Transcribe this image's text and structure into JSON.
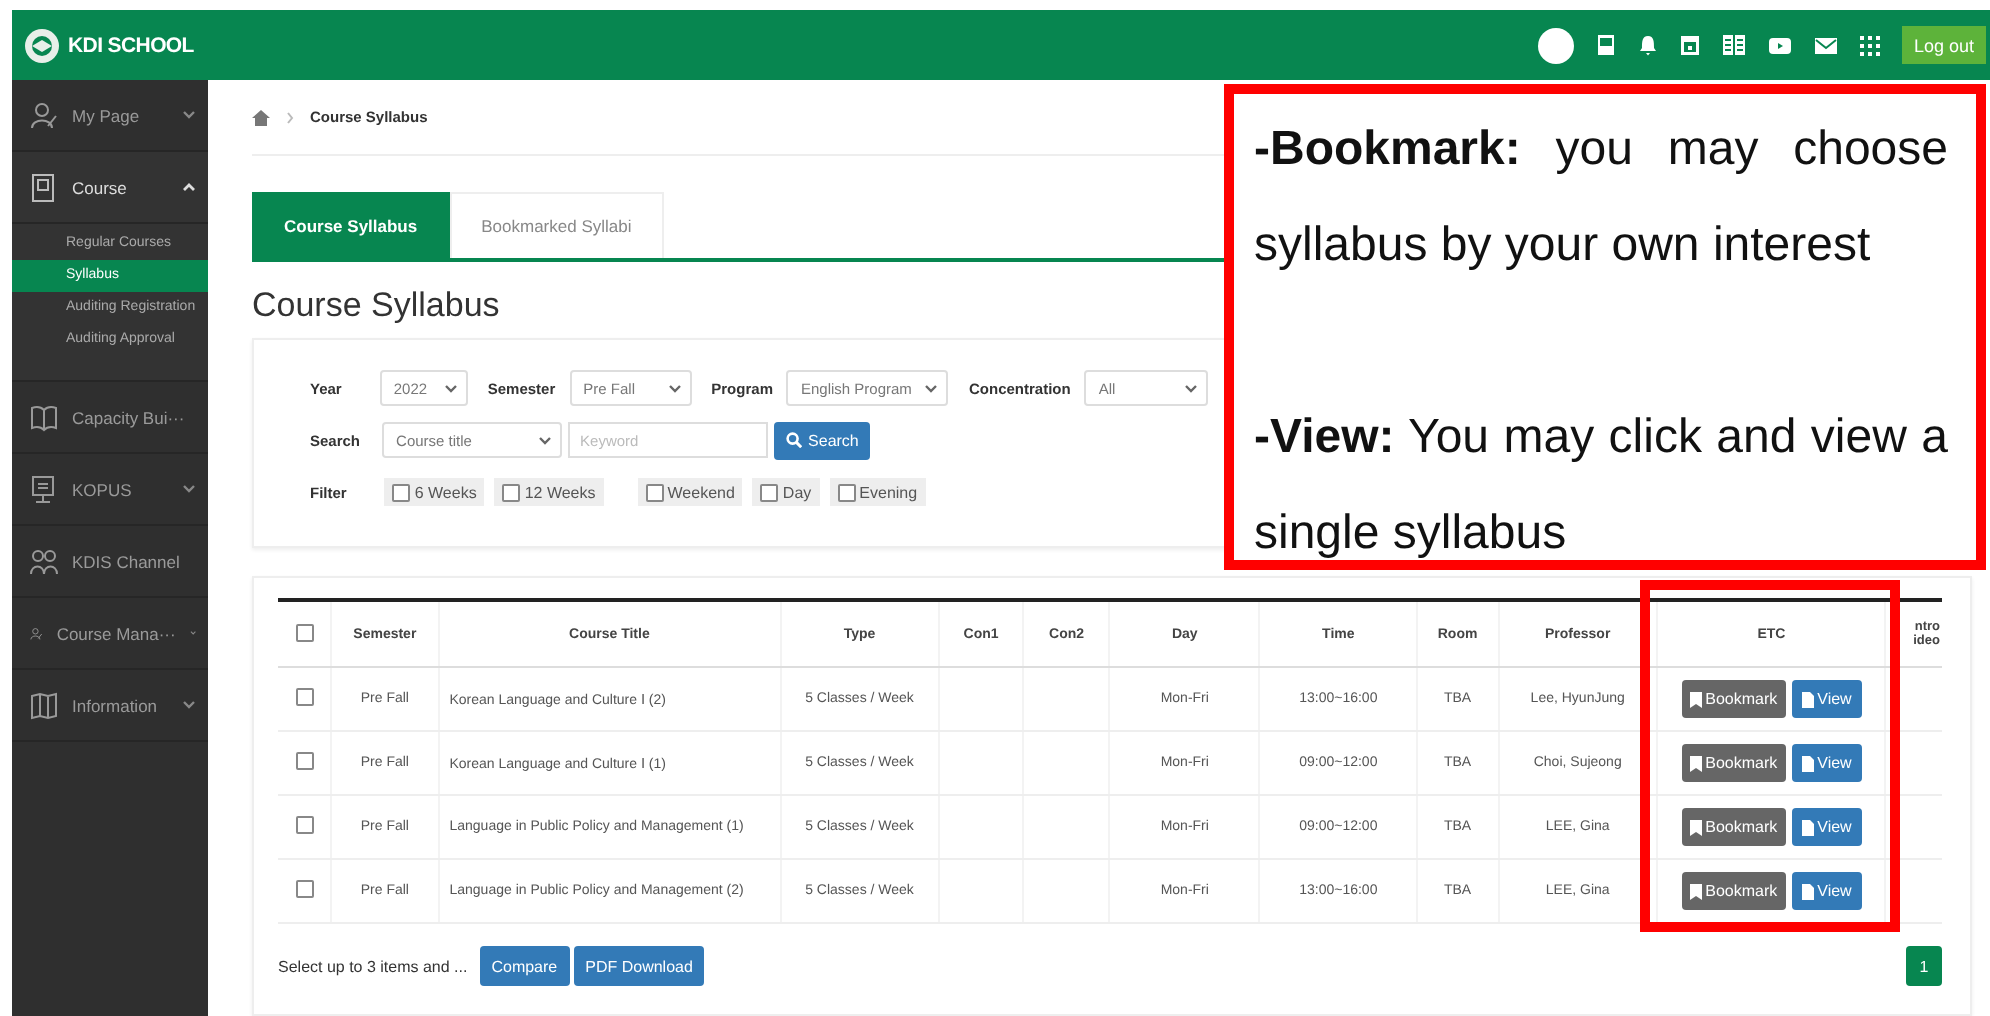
{
  "header": {
    "logo": "KDI SCHOOL",
    "logout": "Log out"
  },
  "sidebar": {
    "items": [
      {
        "label": "My Page",
        "kind": "group",
        "expanded": false
      },
      {
        "label": "Course",
        "kind": "group",
        "expanded": true,
        "children": [
          {
            "label": "Regular Courses",
            "selected": false
          },
          {
            "label": "Syllabus",
            "selected": true
          },
          {
            "label": "Auditing Registration",
            "selected": false
          },
          {
            "label": "Auditing Approval",
            "selected": false
          }
        ]
      },
      {
        "label": "Capacity Bui···",
        "kind": "link"
      },
      {
        "label": "KOPUS",
        "kind": "group",
        "expanded": false
      },
      {
        "label": "KDIS Channel",
        "kind": "link"
      },
      {
        "label": "Course Mana···",
        "kind": "group",
        "expanded": false
      },
      {
        "label": "Information",
        "kind": "group",
        "expanded": false
      }
    ]
  },
  "breadcrumb": "Course Syllabus",
  "tabs": [
    {
      "label": "Course Syllabus",
      "selected": true
    },
    {
      "label": "Bookmarked Syllabi",
      "selected": false
    }
  ],
  "title": "Course Syllabus",
  "filters": {
    "selects": [
      {
        "label": "Year",
        "value": "2022"
      },
      {
        "label": "Semester",
        "value": "Pre Fall"
      },
      {
        "label": "Program",
        "value": "English Program"
      },
      {
        "label": "Concentration",
        "value": "All"
      }
    ],
    "search": {
      "label": "Search",
      "field": "Course title",
      "placeholder": "Keyword",
      "button": "Search"
    },
    "filter": {
      "label": "Filter",
      "options": [
        {
          "label": "6 Weeks",
          "checked": false
        },
        {
          "label": "12 Weeks",
          "checked": false
        },
        {
          "label": "Weekend",
          "checked": false
        },
        {
          "label": "Day",
          "checked": false
        },
        {
          "label": "Evening",
          "checked": false
        }
      ]
    }
  },
  "table": {
    "columns": [
      "Semester",
      "Course Title",
      "Type",
      "Con1",
      "Con2",
      "Day",
      "Time",
      "Room",
      "Professor",
      "ETC",
      "ntro ideo"
    ],
    "all_checked": false,
    "rows": [
      {
        "checked": false,
        "cells": [
          "Pre Fall",
          "Korean Language and Culture Ⅰ (2)",
          "5 Classes / Week",
          "",
          "",
          "Mon-Fri",
          "13:00~16:00",
          "TBA",
          "Lee, HyunJung"
        ],
        "actions": [
          "Bookmark",
          "View"
        ]
      },
      {
        "checked": false,
        "cells": [
          "Pre Fall",
          "Korean Language and Culture Ⅰ (1)",
          "5 Classes / Week",
          "",
          "",
          "Mon-Fri",
          "09:00~12:00",
          "TBA",
          "Choi, Sujeong"
        ],
        "actions": [
          "Bookmark",
          "View"
        ]
      },
      {
        "checked": false,
        "cells": [
          "Pre Fall",
          "Language in Public Policy and Management (1)",
          "5 Classes / Week",
          "",
          "",
          "Mon-Fri",
          "09:00~12:00",
          "TBA",
          "LEE, Gina"
        ],
        "actions": [
          "Bookmark",
          "View"
        ]
      },
      {
        "checked": false,
        "cells": [
          "Pre Fall",
          "Language in Public Policy and Management (2)",
          "5 Classes / Week",
          "",
          "",
          "Mon-Fri",
          "13:00~16:00",
          "TBA",
          "LEE, Gina"
        ],
        "actions": [
          "Bookmark",
          "View"
        ]
      }
    ]
  },
  "footer": {
    "hint": "Select up to 3 items and ...",
    "buttons": [
      "Compare",
      "PDF Download"
    ],
    "pages": [
      {
        "label": "1",
        "selected": true
      }
    ]
  },
  "annotation": {
    "paragraphs": [
      "**-Bookmark:** you may choose syllabus by your own interest",
      "**-View:** You may click and view a single syllabus"
    ]
  }
}
